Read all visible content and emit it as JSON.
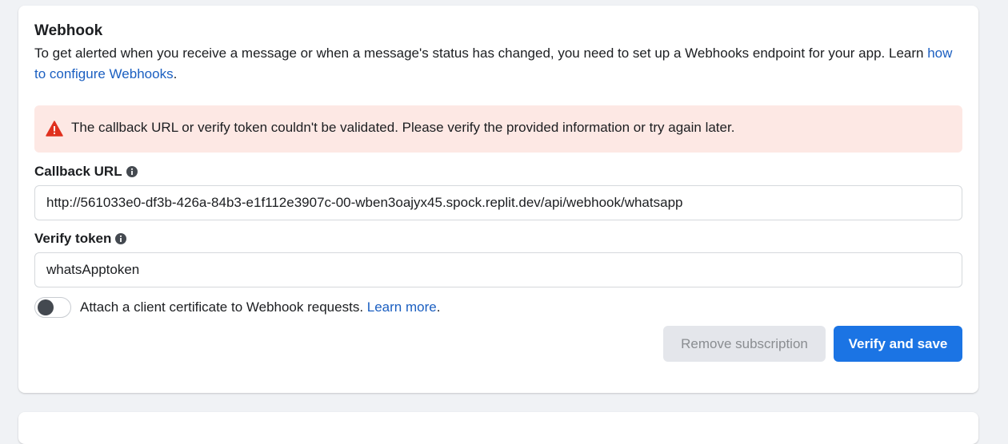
{
  "webhook": {
    "title": "Webhook",
    "description_prefix": "To get alerted when you receive a message or when a message's status has changed, you need to set up a Webhooks endpoint for your app. Learn ",
    "description_link": "how to configure Webhooks",
    "description_suffix": ".",
    "alert": {
      "icon": "warning-icon",
      "message": "The callback URL or verify token couldn't be validated. Please verify the provided information or try again later.",
      "icon_color": "#e0301e",
      "background": "#fde8e4"
    },
    "callback_url": {
      "label": "Callback URL",
      "icon": "info-icon",
      "value": "http://561033e0-df3b-426a-84b3-e1f112e3907c-00-wben3oajyx45.spock.replit.dev/api/webhook/whatsapp"
    },
    "verify_token": {
      "label": "Verify token",
      "icon": "info-icon",
      "value": "whatsApptoken"
    },
    "certificate_toggle": {
      "state": "off",
      "label": "Attach a client certificate to Webhook requests. ",
      "link": "Learn more",
      "suffix": "."
    },
    "buttons": {
      "remove_subscription": "Remove subscription",
      "verify_and_save": "Verify and save"
    },
    "colors": {
      "primary": "#1b74e4",
      "link": "#1b5fc1",
      "disabled_button": "#e4e6eb"
    }
  }
}
